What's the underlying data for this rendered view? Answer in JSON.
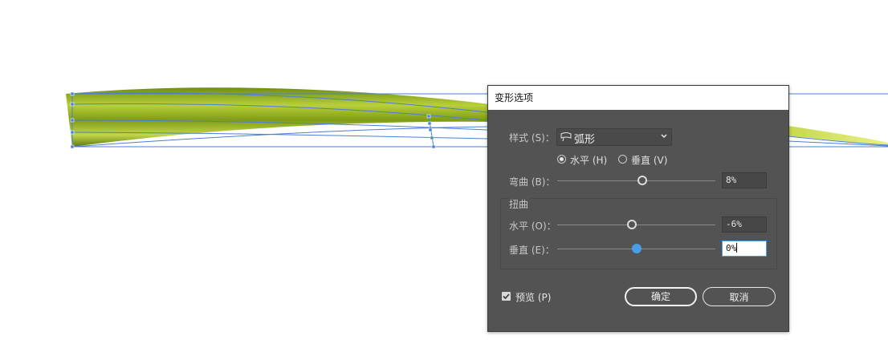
{
  "dialog": {
    "title": "变形选项",
    "style_label": "样式 (S)：",
    "style_value": "弧形",
    "style_icon": "arc-icon",
    "orientation": {
      "horizontal_label": "水平 (H)",
      "vertical_label": "垂直 (V)",
      "selected": "horizontal"
    },
    "bend": {
      "label": "弯曲 (B)：",
      "value": "8%",
      "slider_percent": 8
    },
    "distortion": {
      "group_label": "扭曲",
      "horizontal": {
        "label": "水平 (O)：",
        "value": "-6%",
        "slider_percent": -6
      },
      "vertical": {
        "label": "垂直 (E)：",
        "value": "0%",
        "slider_percent": 0
      }
    },
    "preview": {
      "label": "预览 (P)",
      "checked": true
    },
    "ok_label": "确定",
    "cancel_label": "取消"
  },
  "colors": {
    "dialog_bg": "#535353",
    "accent": "#4a9ee8",
    "path_blue": "#4a7fd6",
    "leaf_green": "#8aa61a"
  }
}
